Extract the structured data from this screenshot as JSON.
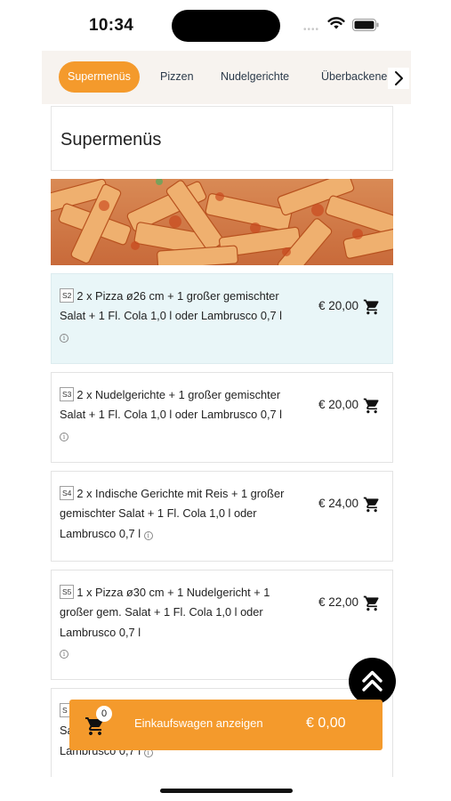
{
  "status_bar": {
    "time": "10:34",
    "icons": [
      "signal-dots-icon",
      "wifi-icon",
      "battery-icon"
    ]
  },
  "category_tabs": [
    {
      "label": "Supermenüs",
      "active": true
    },
    {
      "label": "Pizzen",
      "active": false
    },
    {
      "label": "Nudelgerichte",
      "active": false
    },
    {
      "label": "Überbackene",
      "active": false
    }
  ],
  "section": {
    "title": "Supermenüs",
    "banner_image": "penne-pasta-image"
  },
  "items": [
    {
      "code": "S2",
      "description": "2 x Pizza ø26 cm + 1 großer gemischter Salat + 1 Fl. Cola 1,0 l oder Lambrusco 0,7 l",
      "price": "€ 20,00",
      "highlighted": true
    },
    {
      "code": "S3",
      "description": "2 x Nudelgerichte + 1 großer gemischter Salat + 1 Fl. Cola 1,0 l oder Lambrusco 0,7 l",
      "price": "€ 20,00",
      "highlighted": false
    },
    {
      "code": "S4",
      "description": "2 x Indische Gerichte mit Reis + 1 großer gemischter Salat + 1 Fl. Cola 1,0 l oder Lambrusco 0,7 l",
      "price": "€ 24,00",
      "highlighted": false
    },
    {
      "code": "S5",
      "description": "1 x Pizza ø30 cm + 1 Nudelgericht + 1 großer gem. Salat + 1 Fl. Cola 1,0 l oder Lambrusco 0,7 l",
      "price": "€ 22,00",
      "highlighted": false
    },
    {
      "code": "S",
      "description_partial": [
        "Sa",
        "Lambrusco 0,7 l"
      ]
    }
  ],
  "cart_bar": {
    "count": "0",
    "label": "Einkaufswagen anzeigen",
    "total": "€ 0,00"
  },
  "colors": {
    "accent": "#f49a2c",
    "highlight_row": "#e9f6f8",
    "tab_bar_bg": "#f7f3ef"
  }
}
